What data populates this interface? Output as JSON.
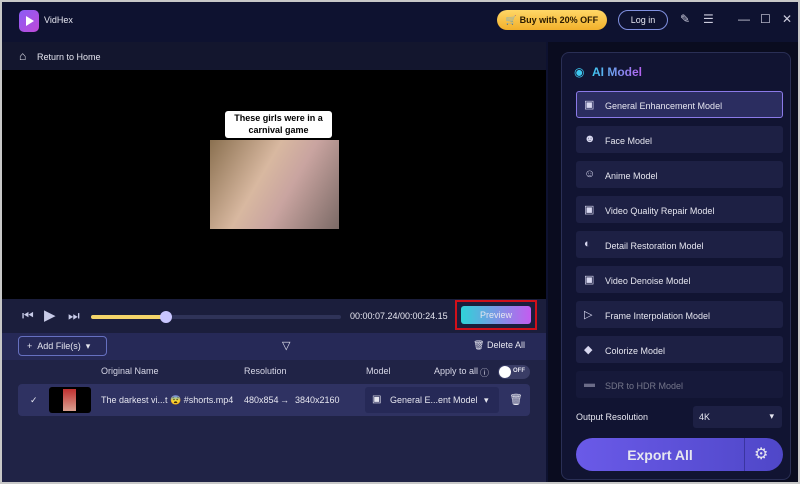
{
  "app": {
    "name": "VidHex",
    "buy_label": "Buy with 20% OFF",
    "login_label": "Log in"
  },
  "nav": {
    "return_label": "Return to Home"
  },
  "video": {
    "caption": "These girls were in a carnival game"
  },
  "player": {
    "time": "00:00:07.24/00:00:24.15",
    "progress": 0.3,
    "preview_label": "Preview"
  },
  "files": {
    "add_label": "Add File(s)",
    "delete_all_label": "Delete All",
    "headers": {
      "name": "Original Name",
      "resolution": "Resolution",
      "model": "Model",
      "apply_all": "Apply to all",
      "toggle": "OFF"
    },
    "rows": [
      {
        "name": "The darkest vi...t 😨 #shorts.mp4",
        "res_from": "480x854",
        "res_to": "3840x2160",
        "model": "General E...ent Model"
      }
    ]
  },
  "panel": {
    "title": "AI Model",
    "models": [
      {
        "label": "General Enhancement Model",
        "icon": "video-plus-icon"
      },
      {
        "label": "Face Model",
        "icon": "face-icon"
      },
      {
        "label": "Anime Model",
        "icon": "anime-icon"
      },
      {
        "label": "Video Quality Repair Model",
        "icon": "video-repair-icon"
      },
      {
        "label": "Detail Restoration Model",
        "icon": "detail-icon"
      },
      {
        "label": "Video Denoise Model",
        "icon": "denoise-icon"
      },
      {
        "label": "Frame Interpolation Model",
        "icon": "frame-icon"
      },
      {
        "label": "Colorize Model",
        "icon": "colorize-icon"
      },
      {
        "label": "SDR to HDR Model",
        "icon": "hdr-icon"
      }
    ],
    "selected": 0,
    "output_label": "Output Resolution",
    "output_value": "4K",
    "export_label": "Export All"
  },
  "colors": {
    "accent": "#6a5ae8",
    "preview_gradient": [
      "#2fd3d8",
      "#c45cf0"
    ],
    "buy": "#f2b02b"
  }
}
